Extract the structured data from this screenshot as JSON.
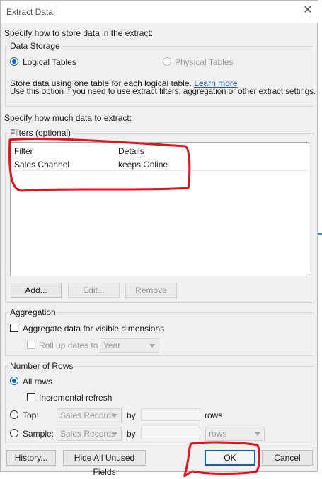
{
  "window": {
    "title": "Extract Data",
    "close_glyph": "✕"
  },
  "store_prompt": "Specify how to store data in the extract:",
  "data_storage": {
    "group_label": "Data Storage",
    "option_logical": "Logical Tables",
    "option_physical": "Physical Tables",
    "selected": "Logical Tables",
    "description_line1": "Store data using one table for each logical table.",
    "learn_more": "Learn more",
    "description_line2": "Use this option if you need to use extract filters, aggregation or other extract settings."
  },
  "amount_prompt": "Specify how much data to extract:",
  "filters": {
    "group_label": "Filters (optional)",
    "columns": [
      "Filter",
      "Details"
    ],
    "rows": [
      {
        "filter": "Sales Channel",
        "details": "keeps Online"
      }
    ],
    "add_label": "Add...",
    "edit_label": "Edit...",
    "remove_label": "Remove"
  },
  "aggregation": {
    "group_label": "Aggregation",
    "aggregate_label": "Aggregate data for visible dimensions",
    "rollup_label": "Roll up dates to",
    "rollup_value": "Year"
  },
  "rows": {
    "group_label": "Number of Rows",
    "all_rows_label": "All rows",
    "incremental_label": "Incremental refresh",
    "top_label": "Top:",
    "top_combo": "Sales Records",
    "by_label": "by",
    "rows_label": "rows",
    "sample_label": "Sample:",
    "sample_combo": "Sales Records",
    "sample_by_label": "by",
    "sample_unit": "rows"
  },
  "footer": {
    "history_label": "History...",
    "hide_unused_label": "Hide All Unused Fields",
    "ok_label": "OK",
    "cancel_label": "Cancel"
  },
  "colors": {
    "accent": "#0a64c8",
    "annotation": "#e0141e",
    "dialog_bg": "#f0f0f0"
  }
}
